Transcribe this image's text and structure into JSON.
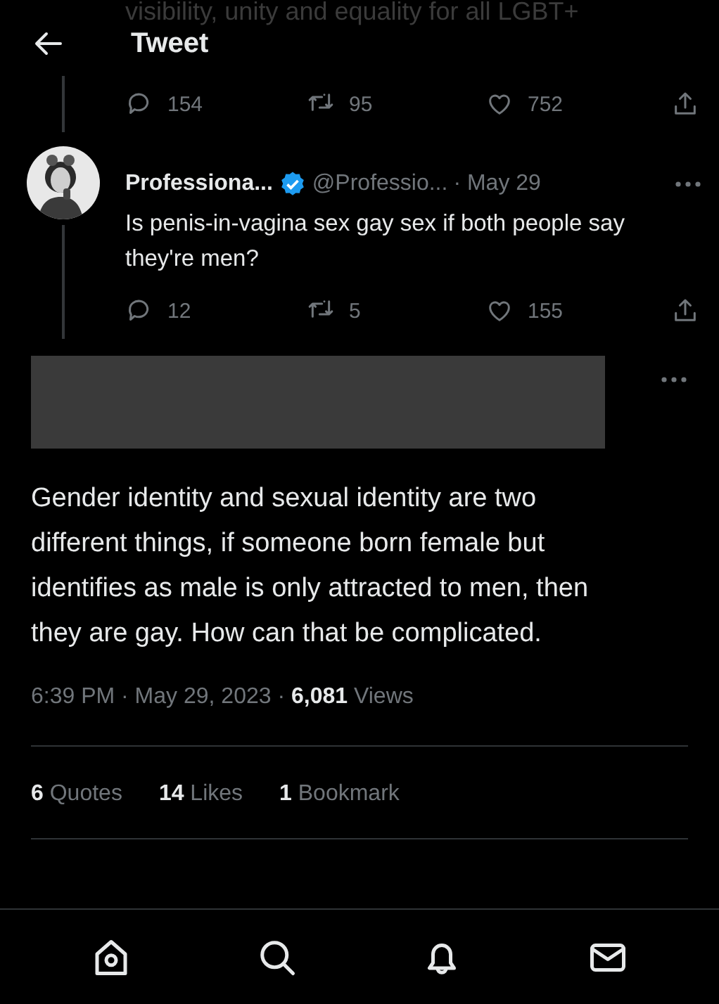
{
  "header": {
    "title": "Tweet",
    "behind_text": "visibility, unity and equality for all LGBT+"
  },
  "parent_tweet": {
    "actions": [
      {
        "kind": "reply",
        "count": "154"
      },
      {
        "kind": "retweet",
        "count": "95"
      },
      {
        "kind": "like",
        "count": "752"
      },
      {
        "kind": "share"
      }
    ]
  },
  "reply_tweet": {
    "display_name": "Professiona...",
    "verified": true,
    "handle": "@Professio...",
    "date": "· May 29",
    "text": "Is penis-in-vagina sex gay sex if both people say they're men?",
    "actions": [
      {
        "kind": "reply",
        "count": "12"
      },
      {
        "kind": "retweet",
        "count": "5"
      },
      {
        "kind": "like",
        "count": "155"
      },
      {
        "kind": "share"
      }
    ]
  },
  "main_tweet": {
    "author_redacted": true,
    "text": "Gender identity and sexual identity are two different things, if someone born female but identifies as male is only attracted to men, then they are gay. How can that be complicated.",
    "time": "6:39 PM · May 29, 2023 ·",
    "views_count": "6,081",
    "views_label": "Views",
    "stats": [
      {
        "count": "6",
        "label": "Quotes"
      },
      {
        "count": "14",
        "label": "Likes"
      },
      {
        "count": "1",
        "label": "Bookmark"
      }
    ]
  },
  "bottom_nav": [
    {
      "kind": "home"
    },
    {
      "kind": "search"
    },
    {
      "kind": "notifications"
    },
    {
      "kind": "messages"
    }
  ]
}
